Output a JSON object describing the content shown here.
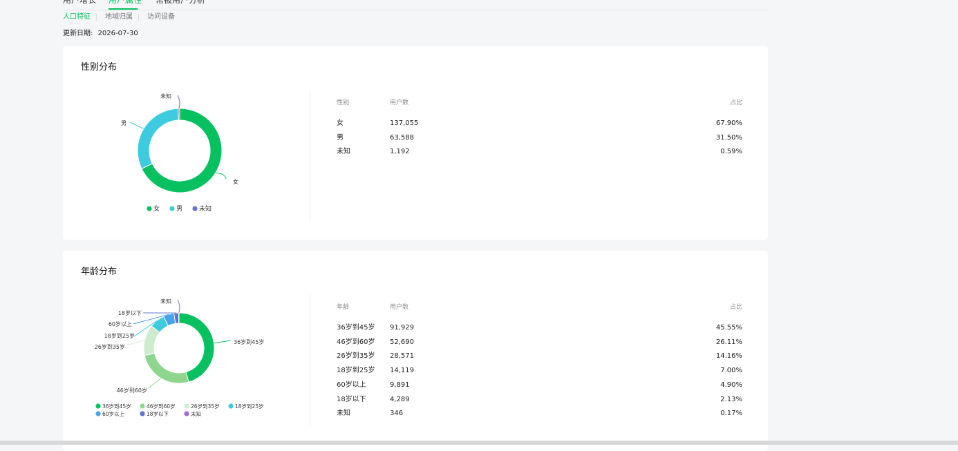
{
  "tabs": [
    {
      "label": "用户增长",
      "active": false
    },
    {
      "label": "用户属性",
      "active": true
    },
    {
      "label": "常被用户分析",
      "active": false
    }
  ],
  "subtabs": [
    {
      "label": "人口特征",
      "active": true
    },
    {
      "label": "地域归属",
      "active": false
    },
    {
      "label": "访问设备",
      "active": false
    }
  ],
  "update": {
    "label": "更新日期:",
    "date": "2026-07-30"
  },
  "gender": {
    "title": "性别分布",
    "columns": [
      "性别",
      "用户数",
      "占比"
    ],
    "rows": [
      {
        "name": "女",
        "count": "137,055",
        "pct": "67.90%"
      },
      {
        "name": "男",
        "count": "63,588",
        "pct": "31.50%"
      },
      {
        "name": "未知",
        "count": "1,192",
        "pct": "0.59%"
      }
    ]
  },
  "age": {
    "title": "年龄分布",
    "columns": [
      "年龄",
      "用户数",
      "占比"
    ],
    "rows": [
      {
        "name": "36岁到45岁",
        "count": "91,929",
        "pct": "45.55%"
      },
      {
        "name": "46岁到60岁",
        "count": "52,690",
        "pct": "26.11%"
      },
      {
        "name": "26岁到35岁",
        "count": "28,571",
        "pct": "14.16%"
      },
      {
        "name": "18岁到25岁",
        "count": "14,119",
        "pct": "7.00%"
      },
      {
        "name": "60岁以上",
        "count": "9,891",
        "pct": "4.90%"
      },
      {
        "name": "18岁以下",
        "count": "4,289",
        "pct": "2.13%"
      },
      {
        "name": "未知",
        "count": "346",
        "pct": "0.17%"
      }
    ]
  },
  "chart_data": [
    {
      "type": "pie",
      "title": "",
      "categories": [
        "女",
        "男",
        "未知"
      ],
      "values": [
        67.9,
        31.5,
        0.59
      ],
      "colors": [
        "#07c160",
        "#3ecbe0",
        "#6a73d4"
      ],
      "legend": "bottom"
    },
    {
      "type": "pie",
      "title": "",
      "categories": [
        "36岁到45岁",
        "46岁到60岁",
        "26岁到35岁",
        "18岁到25岁",
        "60岁以上",
        "18岁以下",
        "未知"
      ],
      "values": [
        45.55,
        26.11,
        14.16,
        7.0,
        4.9,
        2.13,
        0.17
      ],
      "colors": [
        "#07c160",
        "#8ed68e",
        "#cdeccd",
        "#3ecbe0",
        "#4aa3e8",
        "#5f73d0",
        "#9a6cd6"
      ],
      "legend": "bottom"
    }
  ]
}
